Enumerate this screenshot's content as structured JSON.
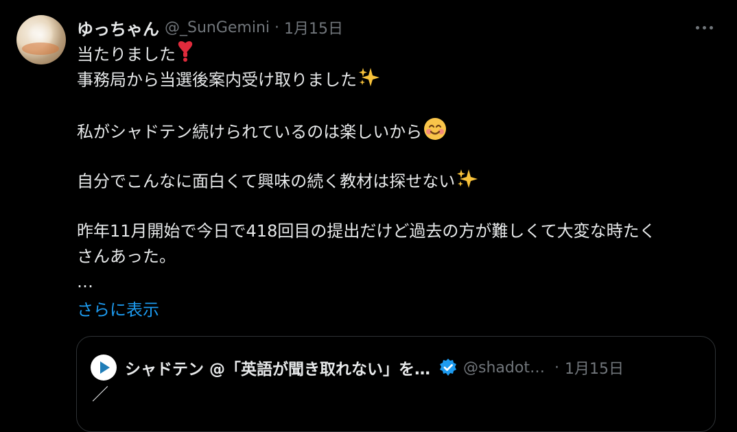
{
  "tweet": {
    "name": "ゆっちゃん",
    "handle": "@_SunGemini",
    "separator": "·",
    "time": "1月15日",
    "lines": [
      "当たりました",
      "事務局から当選後案内受け取りました",
      "",
      "私がシャドテン続けられているのは楽しいから",
      "",
      "自分でこんなに面白くて興味の続く教材は探せない",
      "",
      "昨年11月開始で今日で418回目の提出だけど過去の方が難しくて大変な時たく",
      "さんあった。",
      "…"
    ],
    "show_more": "さらに表示"
  },
  "quote": {
    "name": "シャドテン @「英語が聞き取れない」を…",
    "handle": "@shadot…",
    "separator": "·",
    "time": "1月15日",
    "first_line": "／"
  },
  "icons": {
    "avatar": "avatar",
    "more": "more-icon",
    "heart": "red-exclamation-heart-icon",
    "sparkles": "sparkles-icon",
    "smile": "smiling-face-icon",
    "verified": "verified-badge-icon",
    "logo": "shadoten-play-logo-icon"
  },
  "colors": {
    "background": "#000000",
    "text": "#e7e9ea",
    "muted": "#71767b",
    "link": "#1d9bf0",
    "verified": "#1d9bf0",
    "border": "#2f3336"
  }
}
